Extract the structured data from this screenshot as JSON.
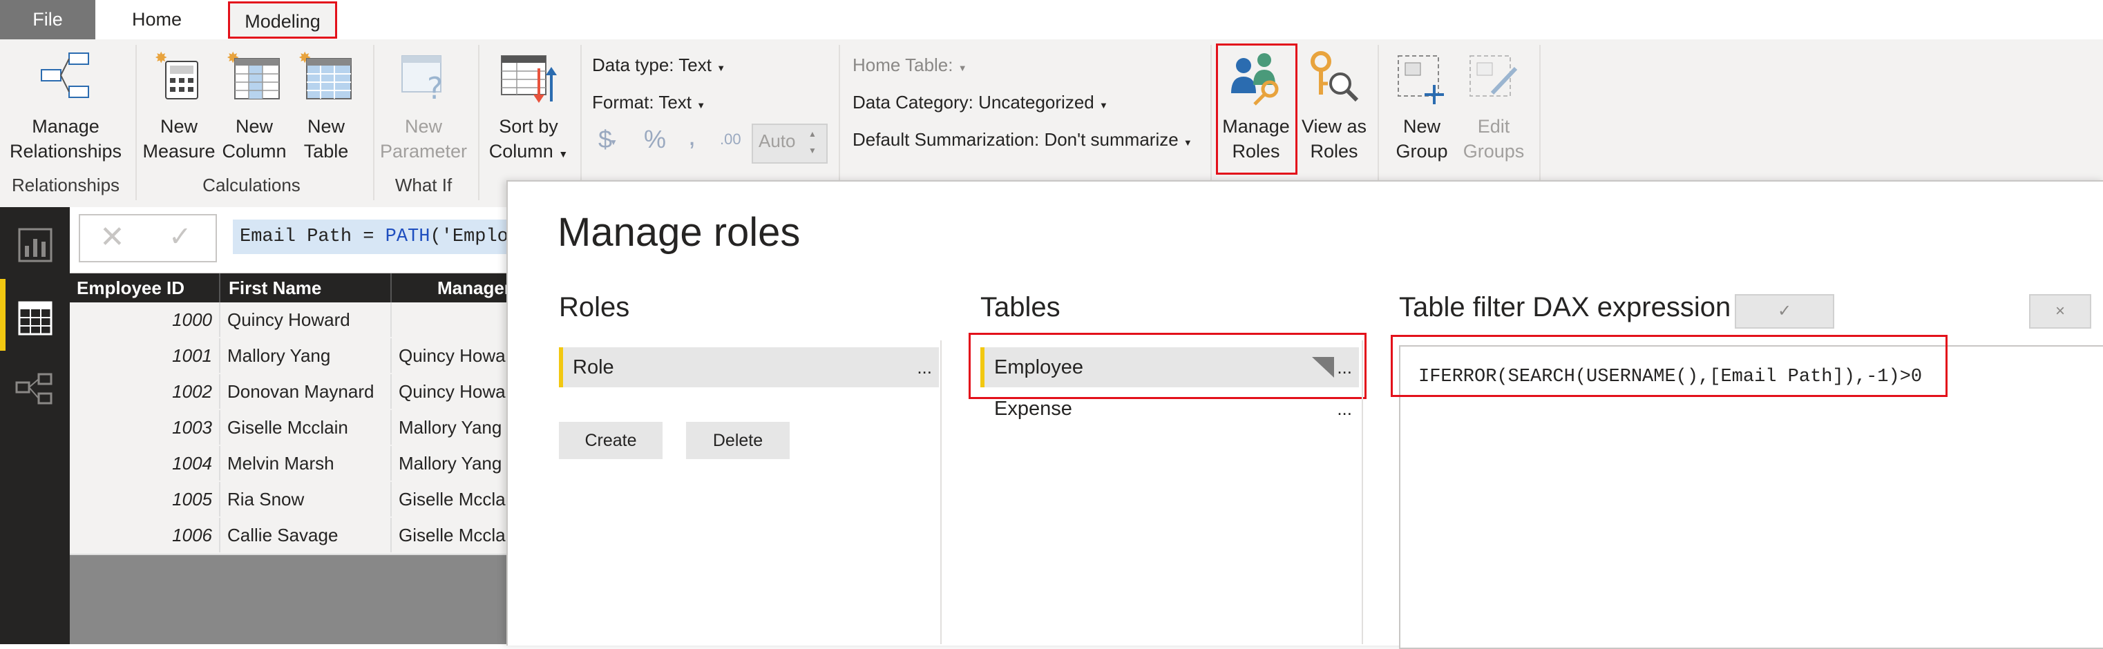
{
  "tabs": {
    "file": "File",
    "home": "Home",
    "modeling": "Modeling"
  },
  "ribbon": {
    "relationships": {
      "button_line1": "Manage",
      "button_line2": "Relationships",
      "group": "Relationships"
    },
    "calculations": {
      "new_measure": [
        "New",
        "Measure"
      ],
      "new_column": [
        "New",
        "Column"
      ],
      "new_table": [
        "New",
        "Table"
      ],
      "group": "Calculations"
    },
    "whatif": {
      "new_parameter": [
        "New",
        "Parameter"
      ],
      "group": "What If"
    },
    "sort": {
      "line1": "Sort by",
      "line2": "Column"
    },
    "formatting": {
      "data_type": "Data type: Text",
      "format": "Format: Text",
      "currency": "$",
      "percent": "%",
      "comma": ",",
      "decimals": ".00",
      "auto": "Auto"
    },
    "properties": {
      "home_table": "Home Table:",
      "data_category": "Data Category: Uncategorized",
      "default_summarization": "Default Summarization: Don't summarize"
    },
    "security": {
      "manage_roles": [
        "Manage",
        "Roles"
      ],
      "view_as_roles": [
        "View as",
        "Roles"
      ]
    },
    "groups": {
      "new_group": [
        "New",
        "Group"
      ],
      "edit_groups": [
        "Edit",
        "Groups"
      ]
    }
  },
  "formula": {
    "prefix": "Email Path = ",
    "func": "PATH",
    "rest": "('Emplo"
  },
  "table": {
    "headers": [
      "Employee ID",
      "First Name",
      "Manager"
    ],
    "rows": [
      [
        "1000",
        "Quincy Howard",
        ""
      ],
      [
        "1001",
        "Mallory Yang",
        "Quincy Howa"
      ],
      [
        "1002",
        "Donovan Maynard",
        "Quincy Howa"
      ],
      [
        "1003",
        "Giselle Mcclain",
        "Mallory Yang"
      ],
      [
        "1004",
        "Melvin Marsh",
        "Mallory Yang"
      ],
      [
        "1005",
        "Ria Snow",
        "Giselle Mccla"
      ],
      [
        "1006",
        "Callie Savage",
        "Giselle Mccla"
      ]
    ]
  },
  "dialog": {
    "title": "Manage roles",
    "roles_header": "Roles",
    "tables_header": "Tables",
    "dax_header": "Table filter DAX expression",
    "roles": [
      "Role"
    ],
    "tables": [
      "Employee",
      "Expense"
    ],
    "more": "...",
    "create": "Create",
    "delete": "Delete",
    "dax_expression": "IFERROR(SEARCH(USERNAME(),[Email Path]),-1)>0",
    "accept_symbol": "✓",
    "cancel_symbol": "×"
  },
  "colors": {
    "accent_yellow": "#f2c811",
    "highlight_red": "#e3111b",
    "file_tab": "#767676"
  }
}
